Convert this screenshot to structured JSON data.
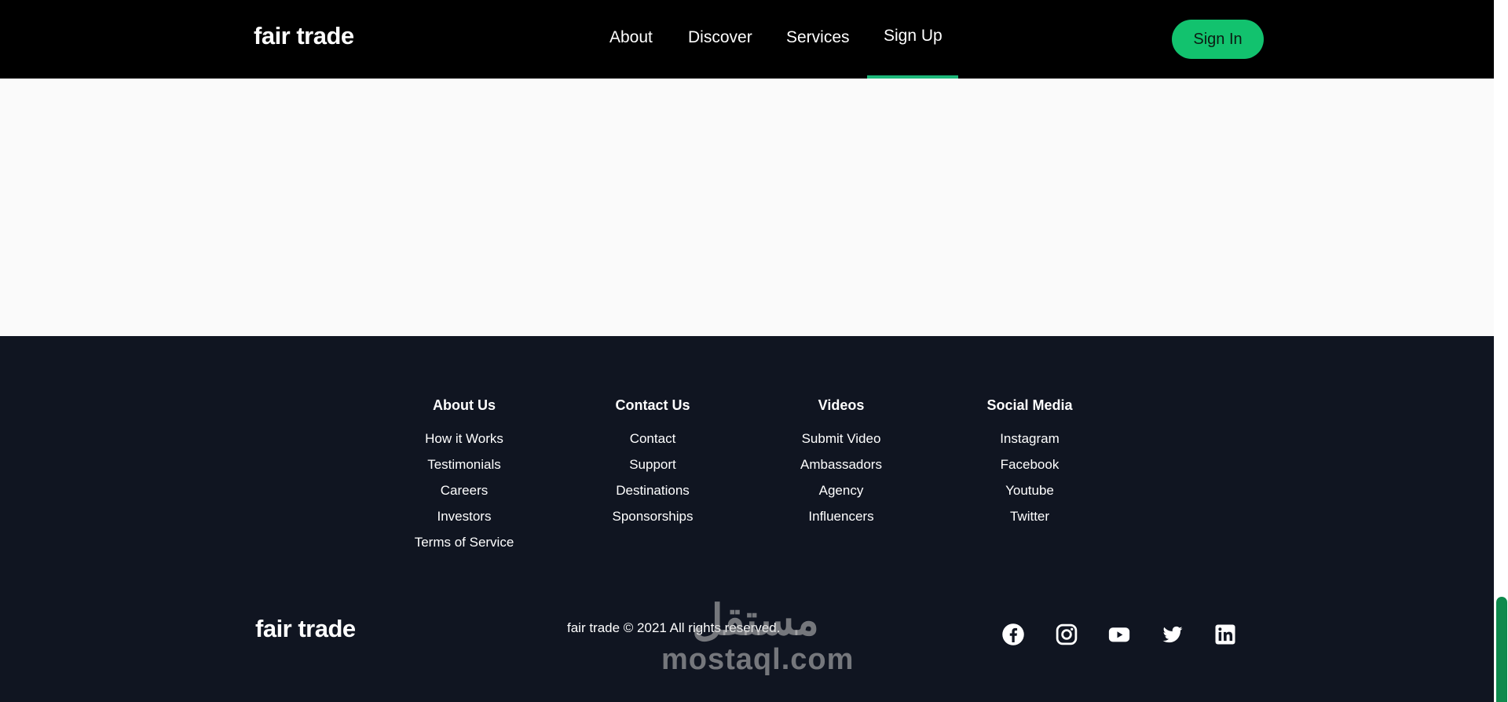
{
  "header": {
    "logo": "fair trade",
    "nav": [
      "About",
      "Discover",
      "Services",
      "Sign Up"
    ],
    "active_nav": "Sign Up",
    "signin_label": "Sign In"
  },
  "footer": {
    "columns": [
      {
        "title": "About Us",
        "links": [
          "How it Works",
          "Testimonials",
          "Careers",
          "Investors",
          "Terms of Service"
        ]
      },
      {
        "title": "Contact Us",
        "links": [
          "Contact",
          "Support",
          "Destinations",
          "Sponsorships"
        ]
      },
      {
        "title": "Videos",
        "links": [
          "Submit Video",
          "Ambassadors",
          "Agency",
          "Influencers"
        ]
      },
      {
        "title": "Social Media",
        "links": [
          "Instagram",
          "Facebook",
          "Youtube",
          "Twitter"
        ]
      }
    ],
    "logo": "fair trade",
    "copyright": "fair trade © 2021 All rights reserved.",
    "social_icons": [
      "facebook-icon",
      "instagram-icon",
      "youtube-icon",
      "twitter-icon",
      "linkedin-icon"
    ]
  },
  "watermark": {
    "arabic": "مستقل",
    "latin": "mostaql.com"
  },
  "colors": {
    "accent": "#12c26e",
    "footer_bg": "#101521",
    "header_bg": "#000000"
  }
}
